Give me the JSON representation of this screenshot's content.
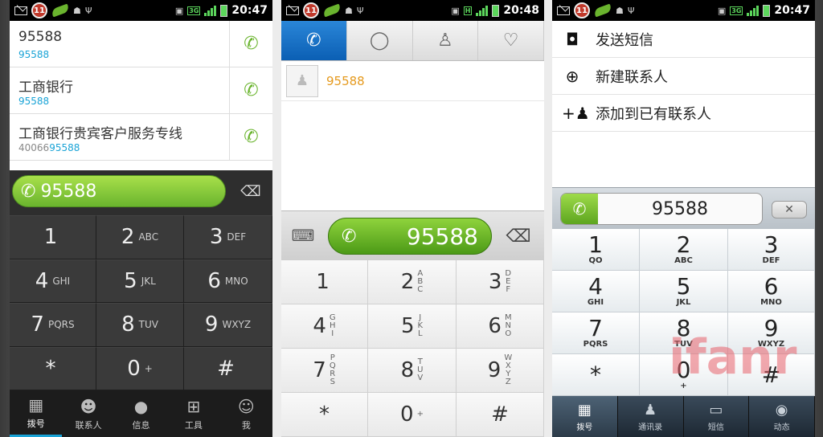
{
  "status_bars": [
    {
      "badge": "11",
      "time": "20:47",
      "net": "3G"
    },
    {
      "badge": "11",
      "time": "20:48",
      "net": "H"
    },
    {
      "badge": "11",
      "time": "20:47",
      "net": "3G"
    }
  ],
  "screen1": {
    "contacts": [
      {
        "name": "95588",
        "number_gray": "",
        "number_hl": "95588"
      },
      {
        "name": "工商银行",
        "number_gray": "",
        "number_hl": "95588"
      },
      {
        "name": "工商银行贵宾客户服务专线",
        "number_gray": "40066",
        "number_hl": "95588"
      }
    ],
    "input_value": "95588",
    "keys": [
      {
        "d": "1",
        "l": ""
      },
      {
        "d": "2",
        "l": "ABC"
      },
      {
        "d": "3",
        "l": "DEF"
      },
      {
        "d": "4",
        "l": "GHI"
      },
      {
        "d": "5",
        "l": "JKL"
      },
      {
        "d": "6",
        "l": "MNO"
      },
      {
        "d": "7",
        "l": "PQRS"
      },
      {
        "d": "8",
        "l": "TUV"
      },
      {
        "d": "9",
        "l": "WXYZ"
      },
      {
        "d": "*",
        "l": ""
      },
      {
        "d": "0",
        "l": "+"
      },
      {
        "d": "#",
        "l": ""
      }
    ],
    "tabs": [
      "拨号",
      "联系人",
      "信息",
      "工具",
      "我"
    ]
  },
  "screen2": {
    "result_number": "95588",
    "input_value": "95588",
    "keys": [
      {
        "d": "1",
        "l": [
          "",
          "",
          ""
        ]
      },
      {
        "d": "2",
        "l": [
          "A",
          "B",
          "C"
        ]
      },
      {
        "d": "3",
        "l": [
          "D",
          "E",
          "F"
        ]
      },
      {
        "d": "4",
        "l": [
          "G",
          "H",
          "I"
        ]
      },
      {
        "d": "5",
        "l": [
          "J",
          "K",
          "L"
        ]
      },
      {
        "d": "6",
        "l": [
          "M",
          "N",
          "O"
        ]
      },
      {
        "d": "7",
        "l": [
          "P",
          "Q",
          "R",
          "S"
        ]
      },
      {
        "d": "8",
        "l": [
          "T",
          "U",
          "V"
        ]
      },
      {
        "d": "9",
        "l": [
          "W",
          "X",
          "Y",
          "Z"
        ]
      },
      {
        "d": "*",
        "l": []
      },
      {
        "d": "0",
        "l": [
          "+"
        ]
      },
      {
        "d": "#",
        "l": []
      }
    ]
  },
  "screen3": {
    "menu": [
      {
        "icon": "sms-icon",
        "label": "发送短信"
      },
      {
        "icon": "add-circle-icon",
        "label": "新建联系人"
      },
      {
        "icon": "add-person-icon",
        "label": "添加到已有联系人"
      }
    ],
    "input_value": "95588",
    "keys": [
      {
        "d": "1",
        "l": "QO"
      },
      {
        "d": "2",
        "l": "ABC"
      },
      {
        "d": "3",
        "l": "DEF"
      },
      {
        "d": "4",
        "l": "GHI"
      },
      {
        "d": "5",
        "l": "JKL"
      },
      {
        "d": "6",
        "l": "MNO"
      },
      {
        "d": "7",
        "l": "PQRS"
      },
      {
        "d": "8",
        "l": "TUV"
      },
      {
        "d": "9",
        "l": "WXYZ"
      },
      {
        "d": "*",
        "l": ""
      },
      {
        "d": "0",
        "l": "+"
      },
      {
        "d": "#",
        "l": ""
      }
    ],
    "tabs": [
      "拨号",
      "通讯录",
      "短信",
      "动态"
    ]
  },
  "watermark": "ifanr",
  "colors": {
    "accent_green": "#6ab42e",
    "accent_blue": "#19a3d6",
    "orange": "#e59a1e"
  }
}
